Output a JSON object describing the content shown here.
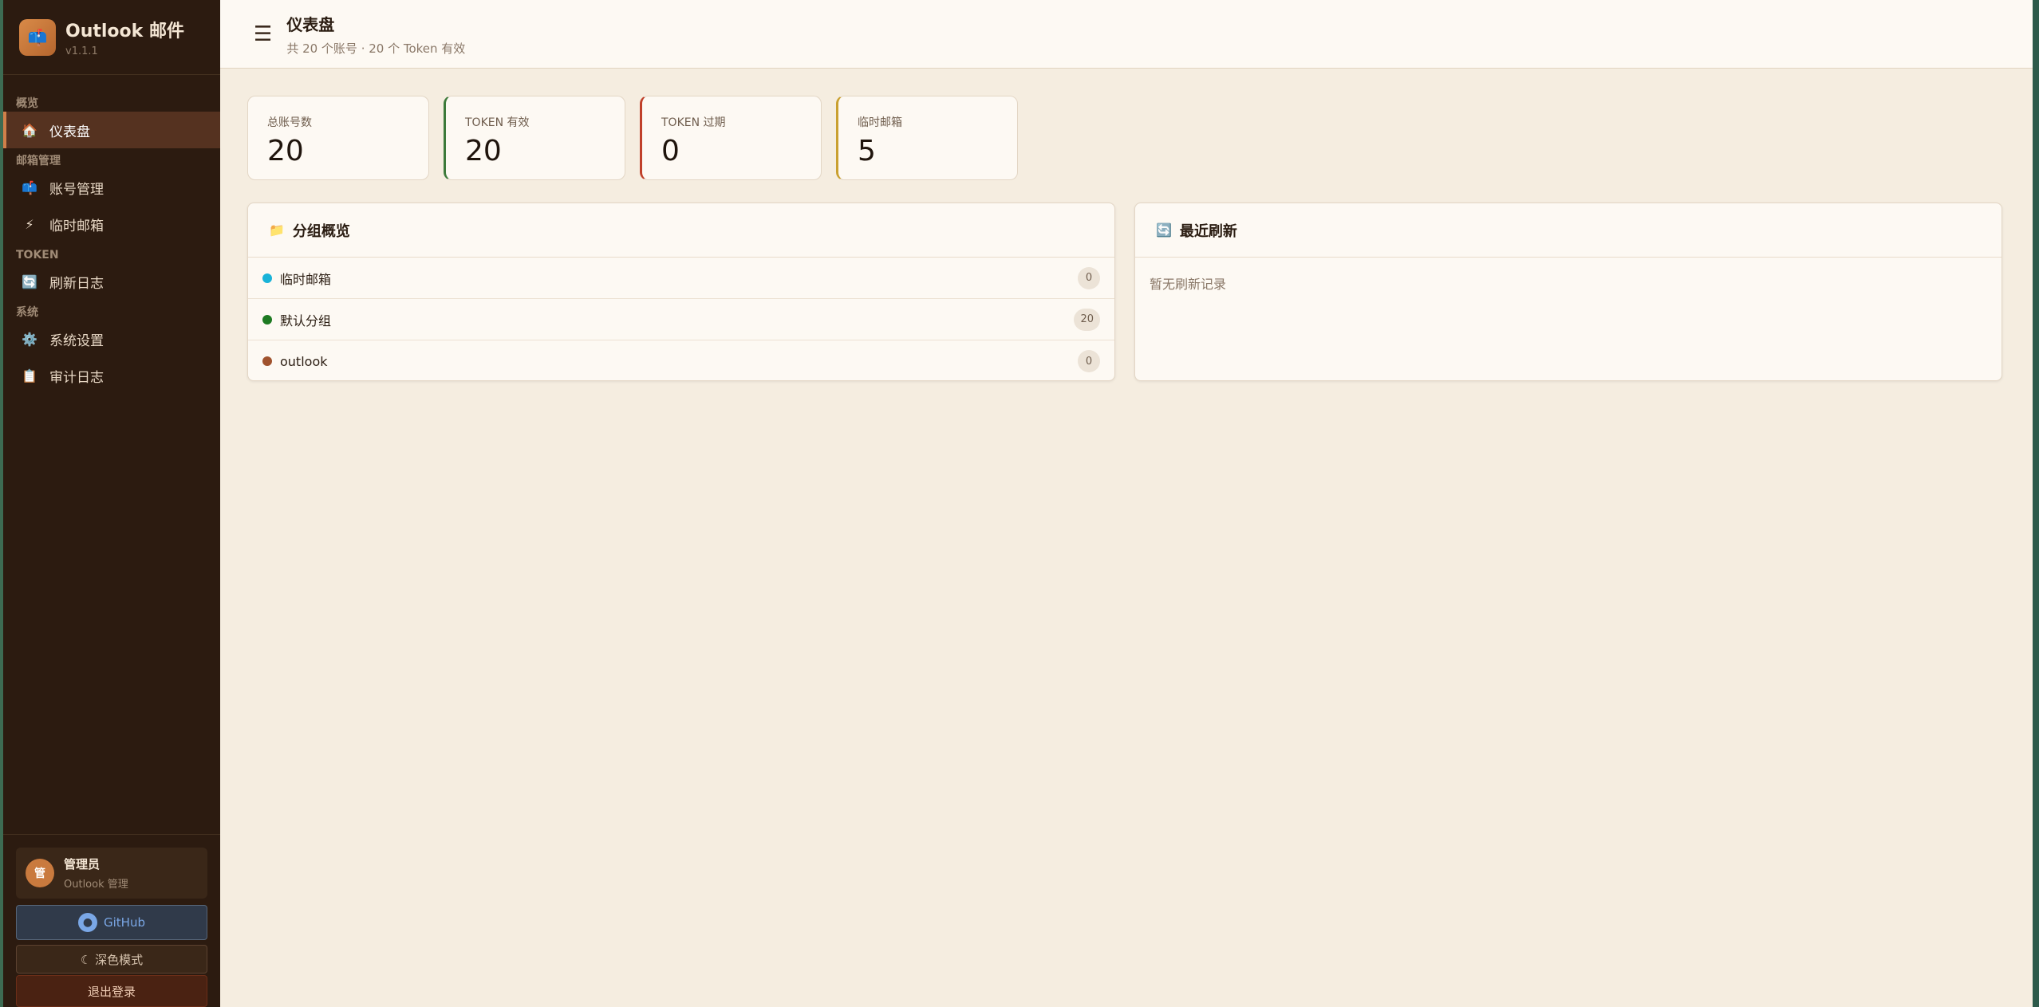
{
  "brand": {
    "title": "Outlook 邮件",
    "version": "v1.1.1",
    "logo_icon": "mailbox-icon"
  },
  "sidebar": {
    "sections": [
      {
        "label": "概览"
      },
      {
        "label": "邮箱管理"
      },
      {
        "label": "TOKEN"
      },
      {
        "label": "系统"
      }
    ],
    "items": [
      {
        "label": "仪表盘",
        "icon": "🏠",
        "active": true
      },
      {
        "label": "账号管理",
        "icon": "📫"
      },
      {
        "label": "临时邮箱",
        "icon": "⚡"
      },
      {
        "label": "刷新日志",
        "icon": "🔄"
      },
      {
        "label": "系统设置",
        "icon": "⚙️"
      },
      {
        "label": "审计日志",
        "icon": "📋"
      }
    ]
  },
  "user": {
    "avatar": "管",
    "name": "管理员",
    "role": "Outlook 管理"
  },
  "buttons": {
    "github": "GitHub",
    "dark_mode": "☾ 深色模式",
    "logout": "退出登录"
  },
  "header": {
    "title": "仪表盘",
    "subtitle": "共 20 个账号 · 20 个 Token 有效"
  },
  "stats": [
    {
      "label": "总账号数",
      "value": "20"
    },
    {
      "label": "TOKEN 有效",
      "value": "20",
      "accent": "#3c7a3a"
    },
    {
      "label": "TOKEN 过期",
      "value": "0",
      "accent": "#c0402a"
    },
    {
      "label": "临时邮箱",
      "value": "5",
      "accent": "#c9a030"
    }
  ],
  "groups_panel": {
    "title": "分组概览",
    "icon": "📁",
    "rows": [
      {
        "name": "临时邮箱",
        "count": "0",
        "color": "#19b3d8"
      },
      {
        "name": "默认分组",
        "count": "20",
        "color": "#1e7a22"
      },
      {
        "name": "outlook",
        "count": "0",
        "color": "#a0522d"
      }
    ]
  },
  "refresh_panel": {
    "title": "最近刷新",
    "icon": "🔄",
    "empty": "暂无刷新记录"
  }
}
